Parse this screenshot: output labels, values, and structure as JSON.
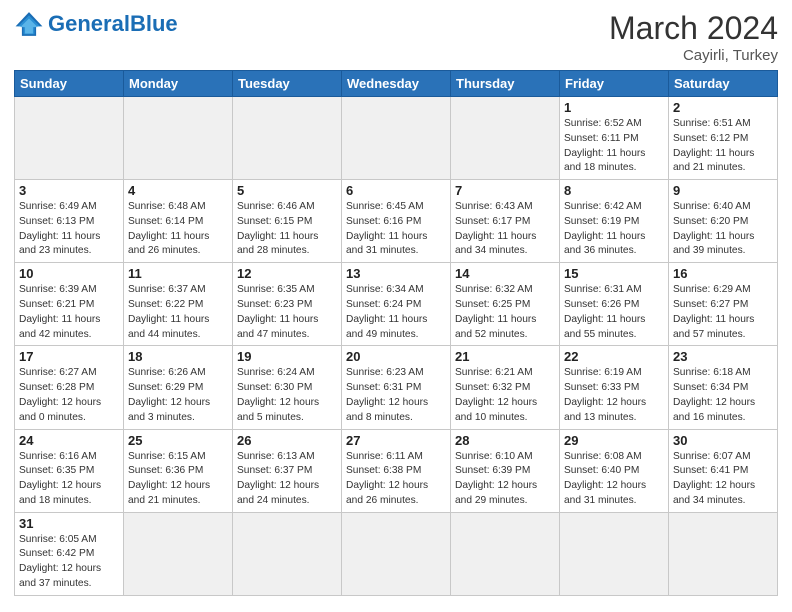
{
  "header": {
    "logo_general": "General",
    "logo_blue": "Blue",
    "month_year": "March 2024",
    "location": "Cayirli, Turkey"
  },
  "weekdays": [
    "Sunday",
    "Monday",
    "Tuesday",
    "Wednesday",
    "Thursday",
    "Friday",
    "Saturday"
  ],
  "weeks": [
    [
      {
        "day": "",
        "info": "",
        "empty": true
      },
      {
        "day": "",
        "info": "",
        "empty": true
      },
      {
        "day": "",
        "info": "",
        "empty": true
      },
      {
        "day": "",
        "info": "",
        "empty": true
      },
      {
        "day": "",
        "info": "",
        "empty": true
      },
      {
        "day": "1",
        "info": "Sunrise: 6:52 AM\nSunset: 6:11 PM\nDaylight: 11 hours and 18 minutes."
      },
      {
        "day": "2",
        "info": "Sunrise: 6:51 AM\nSunset: 6:12 PM\nDaylight: 11 hours and 21 minutes."
      }
    ],
    [
      {
        "day": "3",
        "info": "Sunrise: 6:49 AM\nSunset: 6:13 PM\nDaylight: 11 hours and 23 minutes."
      },
      {
        "day": "4",
        "info": "Sunrise: 6:48 AM\nSunset: 6:14 PM\nDaylight: 11 hours and 26 minutes."
      },
      {
        "day": "5",
        "info": "Sunrise: 6:46 AM\nSunset: 6:15 PM\nDaylight: 11 hours and 28 minutes."
      },
      {
        "day": "6",
        "info": "Sunrise: 6:45 AM\nSunset: 6:16 PM\nDaylight: 11 hours and 31 minutes."
      },
      {
        "day": "7",
        "info": "Sunrise: 6:43 AM\nSunset: 6:17 PM\nDaylight: 11 hours and 34 minutes."
      },
      {
        "day": "8",
        "info": "Sunrise: 6:42 AM\nSunset: 6:19 PM\nDaylight: 11 hours and 36 minutes."
      },
      {
        "day": "9",
        "info": "Sunrise: 6:40 AM\nSunset: 6:20 PM\nDaylight: 11 hours and 39 minutes."
      }
    ],
    [
      {
        "day": "10",
        "info": "Sunrise: 6:39 AM\nSunset: 6:21 PM\nDaylight: 11 hours and 42 minutes."
      },
      {
        "day": "11",
        "info": "Sunrise: 6:37 AM\nSunset: 6:22 PM\nDaylight: 11 hours and 44 minutes."
      },
      {
        "day": "12",
        "info": "Sunrise: 6:35 AM\nSunset: 6:23 PM\nDaylight: 11 hours and 47 minutes."
      },
      {
        "day": "13",
        "info": "Sunrise: 6:34 AM\nSunset: 6:24 PM\nDaylight: 11 hours and 49 minutes."
      },
      {
        "day": "14",
        "info": "Sunrise: 6:32 AM\nSunset: 6:25 PM\nDaylight: 11 hours and 52 minutes."
      },
      {
        "day": "15",
        "info": "Sunrise: 6:31 AM\nSunset: 6:26 PM\nDaylight: 11 hours and 55 minutes."
      },
      {
        "day": "16",
        "info": "Sunrise: 6:29 AM\nSunset: 6:27 PM\nDaylight: 11 hours and 57 minutes."
      }
    ],
    [
      {
        "day": "17",
        "info": "Sunrise: 6:27 AM\nSunset: 6:28 PM\nDaylight: 12 hours and 0 minutes."
      },
      {
        "day": "18",
        "info": "Sunrise: 6:26 AM\nSunset: 6:29 PM\nDaylight: 12 hours and 3 minutes."
      },
      {
        "day": "19",
        "info": "Sunrise: 6:24 AM\nSunset: 6:30 PM\nDaylight: 12 hours and 5 minutes."
      },
      {
        "day": "20",
        "info": "Sunrise: 6:23 AM\nSunset: 6:31 PM\nDaylight: 12 hours and 8 minutes."
      },
      {
        "day": "21",
        "info": "Sunrise: 6:21 AM\nSunset: 6:32 PM\nDaylight: 12 hours and 10 minutes."
      },
      {
        "day": "22",
        "info": "Sunrise: 6:19 AM\nSunset: 6:33 PM\nDaylight: 12 hours and 13 minutes."
      },
      {
        "day": "23",
        "info": "Sunrise: 6:18 AM\nSunset: 6:34 PM\nDaylight: 12 hours and 16 minutes."
      }
    ],
    [
      {
        "day": "24",
        "info": "Sunrise: 6:16 AM\nSunset: 6:35 PM\nDaylight: 12 hours and 18 minutes."
      },
      {
        "day": "25",
        "info": "Sunrise: 6:15 AM\nSunset: 6:36 PM\nDaylight: 12 hours and 21 minutes."
      },
      {
        "day": "26",
        "info": "Sunrise: 6:13 AM\nSunset: 6:37 PM\nDaylight: 12 hours and 24 minutes."
      },
      {
        "day": "27",
        "info": "Sunrise: 6:11 AM\nSunset: 6:38 PM\nDaylight: 12 hours and 26 minutes."
      },
      {
        "day": "28",
        "info": "Sunrise: 6:10 AM\nSunset: 6:39 PM\nDaylight: 12 hours and 29 minutes."
      },
      {
        "day": "29",
        "info": "Sunrise: 6:08 AM\nSunset: 6:40 PM\nDaylight: 12 hours and 31 minutes."
      },
      {
        "day": "30",
        "info": "Sunrise: 6:07 AM\nSunset: 6:41 PM\nDaylight: 12 hours and 34 minutes."
      }
    ],
    [
      {
        "day": "31",
        "info": "Sunrise: 6:05 AM\nSunset: 6:42 PM\nDaylight: 12 hours and 37 minutes.",
        "last": true
      },
      {
        "day": "",
        "info": "",
        "empty": true,
        "last": true
      },
      {
        "day": "",
        "info": "",
        "empty": true,
        "last": true
      },
      {
        "day": "",
        "info": "",
        "empty": true,
        "last": true
      },
      {
        "day": "",
        "info": "",
        "empty": true,
        "last": true
      },
      {
        "day": "",
        "info": "",
        "empty": true,
        "last": true
      },
      {
        "day": "",
        "info": "",
        "empty": true,
        "last": true
      }
    ]
  ]
}
